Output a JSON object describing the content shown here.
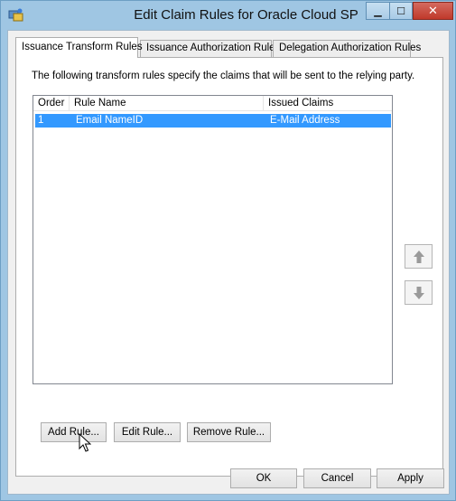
{
  "window": {
    "title": "Edit Claim Rules for Oracle Cloud SP",
    "minimize_glyph": "▁",
    "maximize_glyph": "☐",
    "close_glyph": "✕"
  },
  "tabs": [
    {
      "label": "Issuance Transform Rules",
      "active": true
    },
    {
      "label": "Issuance Authorization Rules",
      "active": false
    },
    {
      "label": "Delegation Authorization Rules",
      "active": false
    }
  ],
  "panel": {
    "description": "The following transform rules specify the claims that will be sent to the relying party."
  },
  "table": {
    "columns": [
      "Order",
      "Rule Name",
      "Issued Claims"
    ],
    "rows": [
      {
        "order": "1",
        "rule_name": "Email NameID",
        "issued_claims": "E-Mail Address",
        "selected": true
      }
    ]
  },
  "icons": {
    "move_up": "arrow-up-icon",
    "move_down": "arrow-down-icon"
  },
  "rule_buttons": {
    "add": "Add Rule...",
    "edit": "Edit Rule...",
    "remove": "Remove Rule..."
  },
  "dialog_buttons": {
    "ok": "OK",
    "cancel": "Cancel",
    "apply": "Apply"
  },
  "colors": {
    "titlebar": "#9fc6e3",
    "selection": "#3399ff",
    "close_button": "#c0392b"
  }
}
